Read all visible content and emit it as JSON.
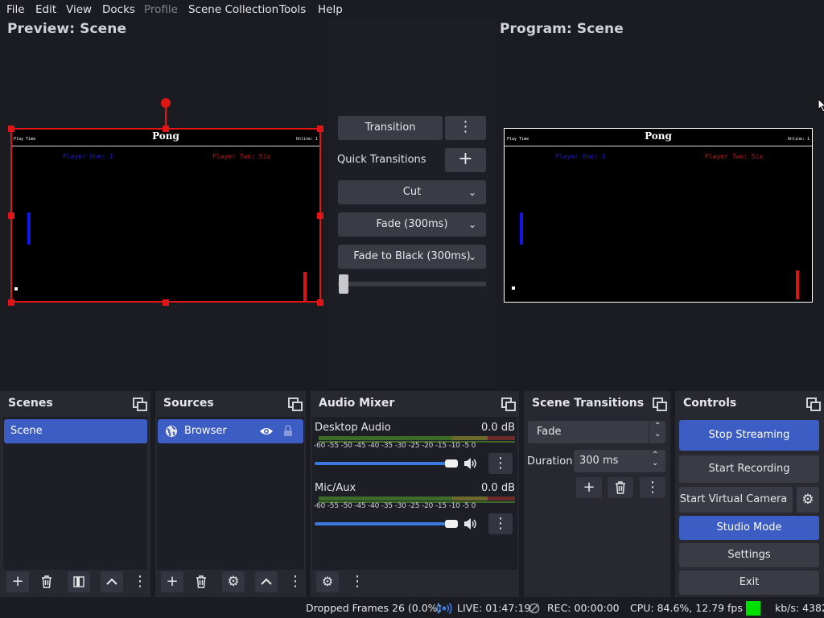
{
  "menu": {
    "file": "File",
    "edit": "Edit",
    "view": "View",
    "docks": "Docks",
    "profile": "Profile",
    "scene_collection": "Scene Collection",
    "tools": "Tools",
    "help": "Help"
  },
  "preview": {
    "title": "Preview: Scene",
    "game_title": "Pong",
    "tiny_left": "Play Time",
    "online": "Online: 1",
    "player_one": "Player One: 1",
    "player_two": "Player Two: Six"
  },
  "program": {
    "title": "Program: Scene",
    "game_title": "Pong",
    "tiny_left": "Play Time",
    "online": "Online: 1",
    "player_one": "Player One: 1",
    "player_two": "Player Two: Six"
  },
  "transitions_panel": {
    "transition_label": "Transition",
    "quick_transitions": "Quick Transitions",
    "cut": "Cut",
    "fade": "Fade (300ms)",
    "fade_black": "Fade to Black (300ms)",
    "t_bar_position": 0.0
  },
  "scenes": {
    "title": "Scenes",
    "items": [
      "Scene"
    ]
  },
  "sources": {
    "title": "Sources",
    "items": [
      {
        "label": "Browser",
        "visible": true,
        "locked": false
      }
    ]
  },
  "audio_mixer": {
    "title": "Audio Mixer",
    "channels": [
      {
        "name": "Desktop Audio",
        "db": "0.0 dB",
        "volume": 1.0
      },
      {
        "name": "Mic/Aux",
        "db": "0.0 dB",
        "volume": 1.0
      }
    ],
    "scale_labels": [
      "-60",
      "-55",
      "-50",
      "-45",
      "-40",
      "-35",
      "-30",
      "-25",
      "-20",
      "-15",
      "-10",
      "-5",
      "0"
    ]
  },
  "scene_transitions": {
    "title": "Scene Transitions",
    "selected": "Fade",
    "duration_label": "Duration",
    "duration_value": "300 ms"
  },
  "controls": {
    "title": "Controls",
    "stop_streaming": "Stop Streaming",
    "start_recording": "Start Recording",
    "start_virtual_camera": "Start Virtual Camera",
    "studio_mode": "Studio Mode",
    "settings": "Settings",
    "exit": "Exit"
  },
  "status_bar": {
    "dropped_frames": "Dropped Frames 26 (0.0%)",
    "live": "LIVE: 01:47:19",
    "rec": "REC: 00:00:00",
    "cpu": "CPU: 84.6%, 12.79 fps",
    "kbps": "kb/s: 4382"
  },
  "colors": {
    "accent": "#3b5dc4",
    "selection": "#e01515",
    "status_ok": "#00e000",
    "live_icon": "#3b7be0"
  }
}
